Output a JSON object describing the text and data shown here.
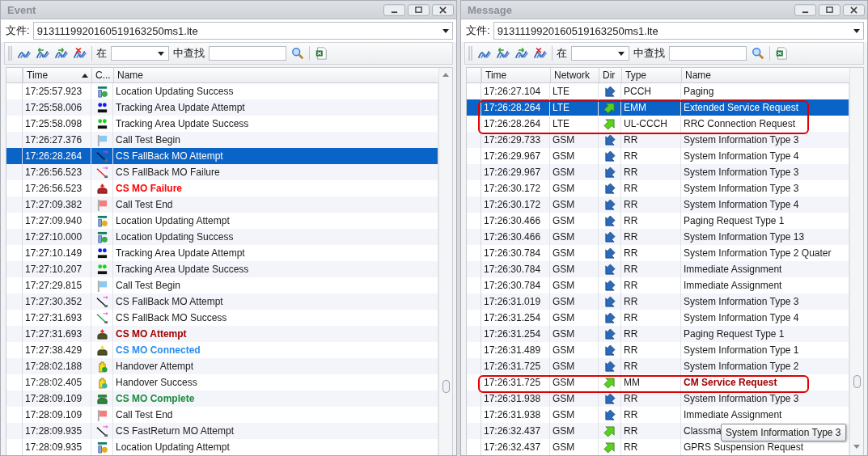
{
  "event_window": {
    "title": "Event",
    "file_label": "文件:",
    "file": "913111992016051916325​0ms1.lte",
    "in_label": "在",
    "find_label": "中查找",
    "columns": [
      {
        "label": "Time",
        "sorted_ascending": true
      },
      {
        "label": "C..."
      },
      {
        "label": "Name"
      }
    ],
    "rows": [
      {
        "time": "17:25:57.923",
        "kind": "lac-success",
        "name": "Location Updating Success",
        "selected": false
      },
      {
        "time": "17:25:58.006",
        "kind": "tac-attempt",
        "name": "Tracking Area Update Attempt",
        "selected": false
      },
      {
        "time": "17:25:58.098",
        "kind": "tac-success",
        "name": "Tracking Area Update Success",
        "selected": false
      },
      {
        "time": "17:26:27.376",
        "kind": "flag-begin",
        "name": "Call Test Begin",
        "selected": false
      },
      {
        "time": "17:26:28.264",
        "kind": "csfb-attempt",
        "name": "CS FallBack MO Attempt",
        "selected": true
      },
      {
        "time": "17:26:56.523",
        "kind": "csfb-failure",
        "name": "CS FallBack MO Failure",
        "selected": false
      },
      {
        "time": "17:26:56.523",
        "kind": "mo-failure",
        "name": "CS MO Failure",
        "selected": false,
        "color": "#ff0000"
      },
      {
        "time": "17:27:09.382",
        "kind": "flag-end",
        "name": "Call Test End",
        "selected": false
      },
      {
        "time": "17:27:09.940",
        "kind": "lac-attempt",
        "name": "Location Updating Attempt",
        "selected": false
      },
      {
        "time": "17:27:10.000",
        "kind": "lac-success",
        "name": "Location Updating Success",
        "selected": false
      },
      {
        "time": "17:27:10.149",
        "kind": "tac-attempt",
        "name": "Tracking Area Update Attempt",
        "selected": false
      },
      {
        "time": "17:27:10.207",
        "kind": "tac-success",
        "name": "Tracking Area Update Success",
        "selected": false
      },
      {
        "time": "17:27:29.815",
        "kind": "flag-begin",
        "name": "Call Test Begin",
        "selected": false
      },
      {
        "time": "17:27:30.352",
        "kind": "csfb-attempt",
        "name": "CS FallBack MO Attempt",
        "selected": false
      },
      {
        "time": "17:27:31.693",
        "kind": "csfb-success",
        "name": "CS FallBack MO Success",
        "selected": false
      },
      {
        "time": "17:27:31.693",
        "kind": "mo-attempt",
        "name": "CS MO Attempt",
        "selected": false,
        "color": "#a00000"
      },
      {
        "time": "17:27:38.429",
        "kind": "mo-connected",
        "name": "CS MO Connected",
        "selected": false,
        "color": "#2a8cf0"
      },
      {
        "time": "17:28:02.188",
        "kind": "handover-attempt",
        "name": "Handover Attempt",
        "selected": false
      },
      {
        "time": "17:28:02.405",
        "kind": "handover-success",
        "name": "Handover Success",
        "selected": false
      },
      {
        "time": "17:28:09.109",
        "kind": "mo-complete",
        "name": "CS MO Complete",
        "selected": false,
        "color": "#1a8a3a"
      },
      {
        "time": "17:28:09.109",
        "kind": "flag-end",
        "name": "Call Test End",
        "selected": false
      },
      {
        "time": "17:28:09.935",
        "kind": "fastreturn-attempt",
        "name": "CS FastReturn MO Attempt",
        "selected": false
      },
      {
        "time": "17:28:09.935",
        "kind": "lac-attempt",
        "name": "Location Updating Attempt",
        "selected": false
      }
    ]
  },
  "message_window": {
    "title": "Message",
    "file_label": "文件:",
    "file": "913111992016051916325​0ms1.lte",
    "in_label": "在",
    "find_label": "中查找",
    "columns": [
      {
        "label": "Time"
      },
      {
        "label": "Network"
      },
      {
        "label": "Dir"
      },
      {
        "label": "Type"
      },
      {
        "label": "Name"
      }
    ],
    "rows": [
      {
        "time": "17:26:27.104",
        "network": "LTE",
        "kind": "downlink",
        "type": "PCCH",
        "name": "Paging",
        "selected": false,
        "outlined": false
      },
      {
        "time": "17:26:28.264",
        "network": "LTE",
        "kind": "uplink",
        "type": "EMM",
        "name": "Extended Service Request",
        "selected": true,
        "outlined": true
      },
      {
        "time": "17:26:28.264",
        "network": "LTE",
        "kind": "uplink",
        "type": "UL-CCCH",
        "name": "RRC Connection Request",
        "selected": false,
        "outlined": true
      },
      {
        "time": "17:26:29.733",
        "network": "GSM",
        "kind": "downlink",
        "type": "RR",
        "name": "System Information Type 3",
        "selected": false,
        "outlined": false
      },
      {
        "time": "17:26:29.967",
        "network": "GSM",
        "kind": "downlink",
        "type": "RR",
        "name": "System Information Type 4",
        "selected": false,
        "outlined": false
      },
      {
        "time": "17:26:29.967",
        "network": "GSM",
        "kind": "downlink",
        "type": "RR",
        "name": "System Information Type 3",
        "selected": false,
        "outlined": false
      },
      {
        "time": "17:26:30.172",
        "network": "GSM",
        "kind": "downlink",
        "type": "RR",
        "name": "System Information Type 3",
        "selected": false,
        "outlined": false
      },
      {
        "time": "17:26:30.172",
        "network": "GSM",
        "kind": "downlink",
        "type": "RR",
        "name": "System Information Type 4",
        "selected": false,
        "outlined": false
      },
      {
        "time": "17:26:30.466",
        "network": "GSM",
        "kind": "downlink",
        "type": "RR",
        "name": "Paging Request Type 1",
        "selected": false,
        "outlined": false
      },
      {
        "time": "17:26:30.466",
        "network": "GSM",
        "kind": "downlink",
        "type": "RR",
        "name": "System Information Type 13",
        "selected": false,
        "outlined": false
      },
      {
        "time": "17:26:30.784",
        "network": "GSM",
        "kind": "downlink",
        "type": "RR",
        "name": "System Information Type 2 Quater",
        "selected": false,
        "outlined": false
      },
      {
        "time": "17:26:30.784",
        "network": "GSM",
        "kind": "downlink",
        "type": "RR",
        "name": "Immediate Assignment",
        "selected": false,
        "outlined": false
      },
      {
        "time": "17:26:30.784",
        "network": "GSM",
        "kind": "downlink",
        "type": "RR",
        "name": "Immediate Assignment",
        "selected": false,
        "outlined": false
      },
      {
        "time": "17:26:31.019",
        "network": "GSM",
        "kind": "downlink",
        "type": "RR",
        "name": "System Information Type 3",
        "selected": false,
        "outlined": false
      },
      {
        "time": "17:26:31.254",
        "network": "GSM",
        "kind": "downlink",
        "type": "RR",
        "name": "System Information Type 4",
        "selected": false,
        "outlined": false
      },
      {
        "time": "17:26:31.254",
        "network": "GSM",
        "kind": "downlink",
        "type": "RR",
        "name": "Paging Request Type 1",
        "selected": false,
        "outlined": false
      },
      {
        "time": "17:26:31.489",
        "network": "GSM",
        "kind": "downlink",
        "type": "RR",
        "name": "System Information Type 1",
        "selected": false,
        "outlined": false
      },
      {
        "time": "17:26:31.725",
        "network": "GSM",
        "kind": "downlink",
        "type": "RR",
        "name": "System Information Type 2",
        "selected": false,
        "outlined": false
      },
      {
        "time": "17:26:31.725",
        "network": "GSM",
        "kind": "uplink",
        "type": "MM",
        "name": "CM Service Request",
        "selected": false,
        "outlined": true,
        "color": "#a00000"
      },
      {
        "time": "17:26:31.938",
        "network": "GSM",
        "kind": "downlink",
        "type": "RR",
        "name": "System Information Type 3",
        "selected": false,
        "outlined": false
      },
      {
        "time": "17:26:31.938",
        "network": "GSM",
        "kind": "downlink",
        "type": "RR",
        "name": "Immediate Assignment",
        "selected": false,
        "outlined": false
      },
      {
        "time": "17:26:32.437",
        "network": "GSM",
        "kind": "uplink",
        "type": "RR",
        "name": "Classma",
        "selected": false,
        "outlined": false
      },
      {
        "time": "17:26:32.437",
        "network": "GSM",
        "kind": "uplink",
        "type": "RR",
        "name": "GPRS Suspension Request",
        "selected": false,
        "outlined": false
      }
    ],
    "tooltip": "System Information Type 3"
  }
}
